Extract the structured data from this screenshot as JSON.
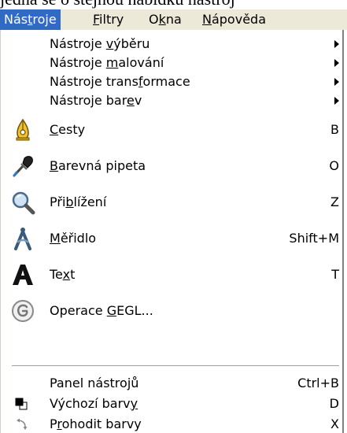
{
  "document": {
    "text_above": "jedná se o stejnou nabídku nástroj"
  },
  "menubar": {
    "items": [
      {
        "pre": "Nás",
        "key": "t",
        "post": "roje"
      },
      {
        "pre": "",
        "key": "F",
        "post": "iltry"
      },
      {
        "pre": "O",
        "key": "k",
        "post": "na"
      },
      {
        "pre": "",
        "key": "N",
        "post": "ápověda"
      }
    ]
  },
  "menu": {
    "submenus": [
      {
        "pre": "Nástroje ",
        "key": "v",
        "post": "ýběru"
      },
      {
        "pre": "Nástroje ",
        "key": "m",
        "post": "alování"
      },
      {
        "pre": "Nástroje trans",
        "key": "f",
        "post": "ormace"
      },
      {
        "pre": "Nástroje bar",
        "key": "e",
        "post": "v"
      }
    ],
    "tools": [
      {
        "icon": "paths-icon",
        "pre": "",
        "key": "C",
        "post": "esty",
        "shortcut": "B"
      },
      {
        "icon": "color-picker-icon",
        "pre": "",
        "key": "B",
        "post": "arevná pipeta",
        "shortcut": "O"
      },
      {
        "icon": "zoom-icon",
        "pre": "Při",
        "key": "b",
        "post": "lížení",
        "shortcut": "Z"
      },
      {
        "icon": "measure-icon",
        "pre": "",
        "key": "M",
        "post": "ěřidlo",
        "shortcut": "Shift+M"
      },
      {
        "icon": "text-icon",
        "pre": "Te",
        "key": "x",
        "post": "t",
        "shortcut": "T"
      },
      {
        "icon": "gegl-icon",
        "pre": "Operace ",
        "key": "G",
        "post": "EGL...",
        "shortcut": ""
      }
    ],
    "bottom": [
      {
        "icon": "",
        "pre": "Panel nástrojů",
        "key": "",
        "post": "",
        "shortcut": "Ctrl+B"
      },
      {
        "icon": "default-colors-icon",
        "pre": "Výchozí barv",
        "key": "y",
        "post": "",
        "shortcut": "D"
      },
      {
        "icon": "swap-colors-icon",
        "pre": "P",
        "key": "r",
        "post": "ohodit barvy",
        "shortcut": "X"
      }
    ]
  },
  "colors": {
    "menubar_bg": "#ece9d8",
    "highlight": "#316ac5"
  }
}
